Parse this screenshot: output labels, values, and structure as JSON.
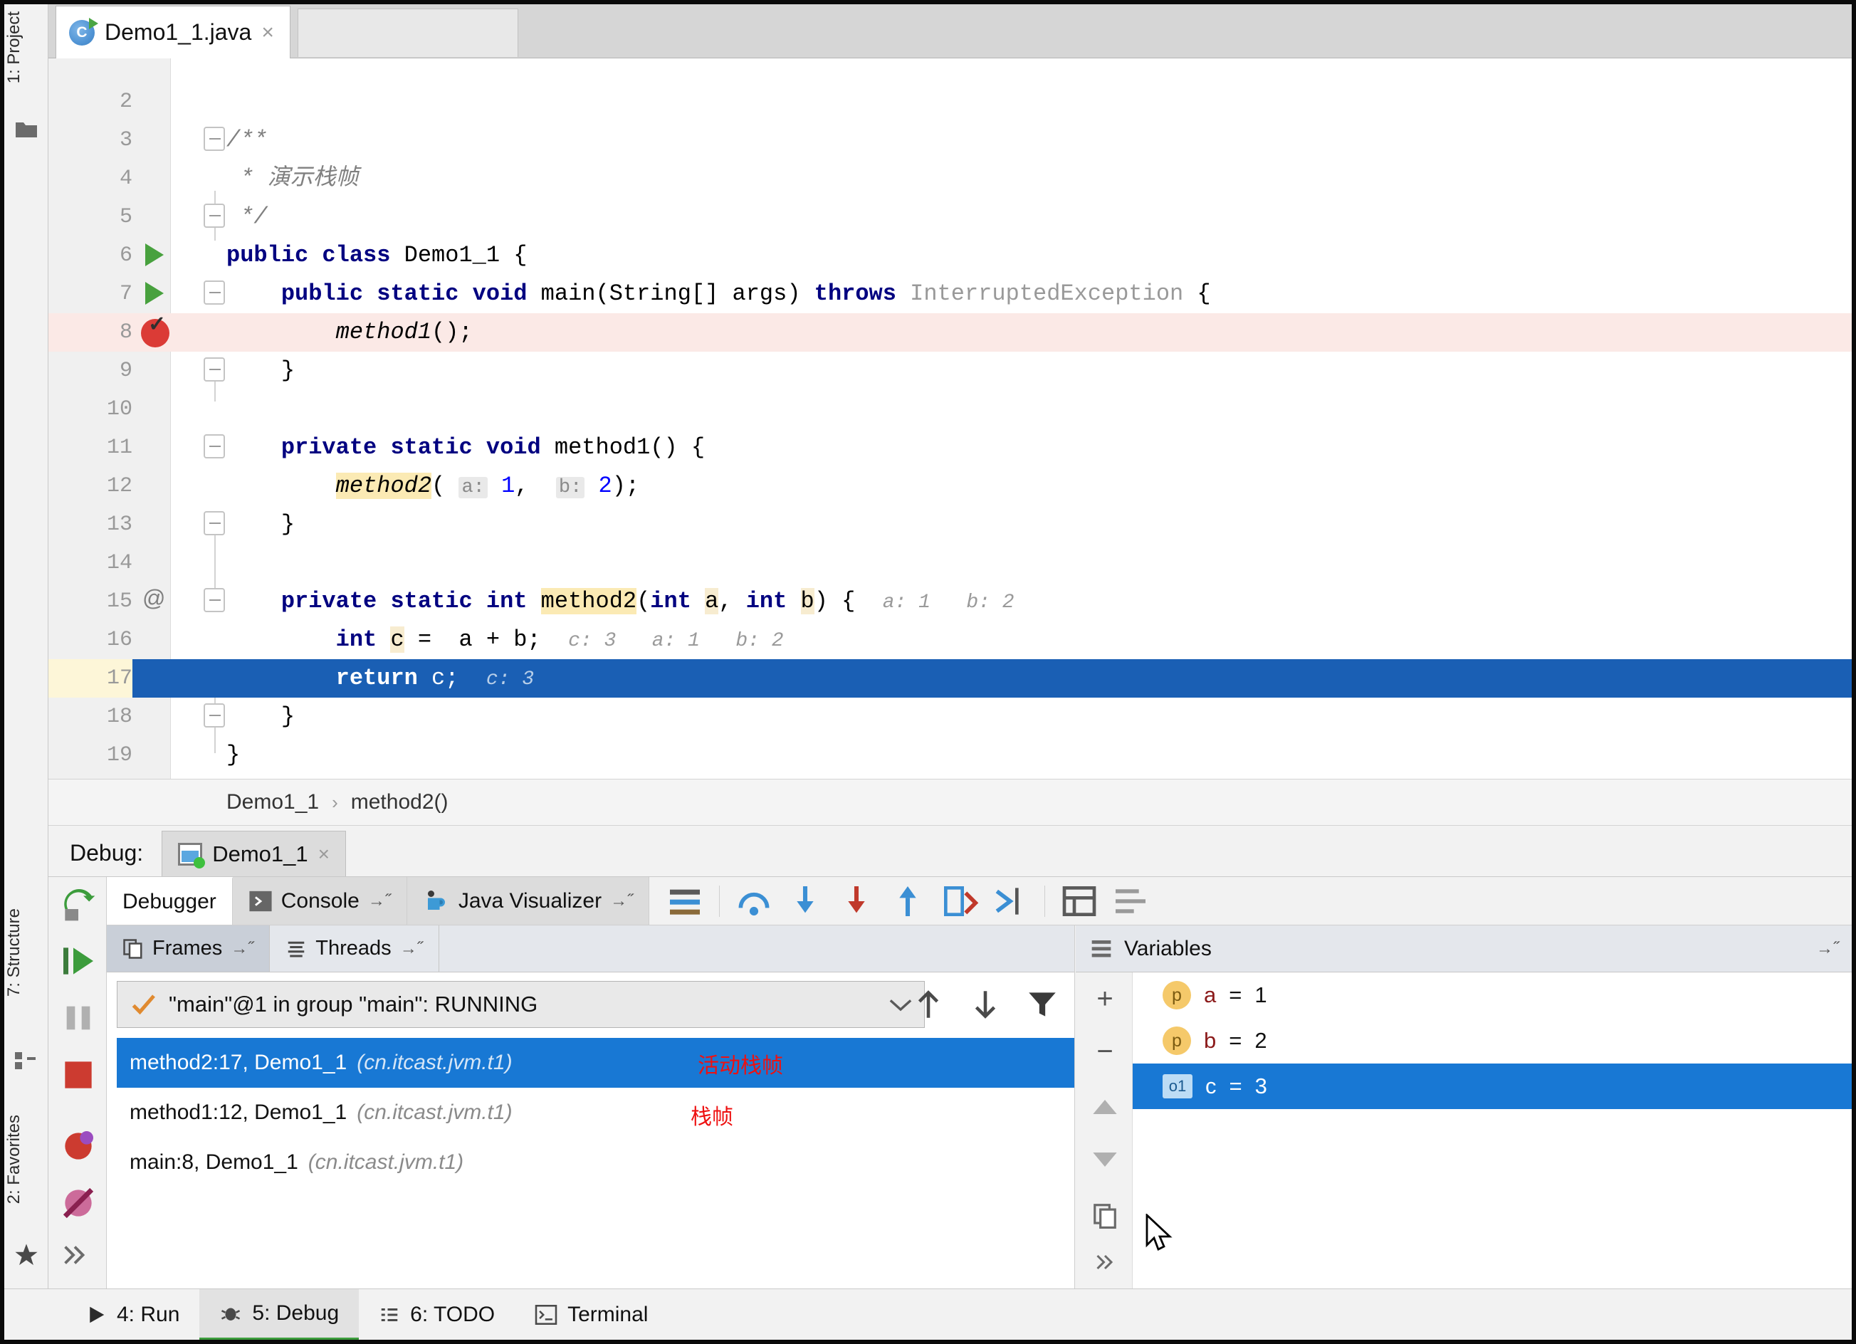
{
  "rail": {
    "project": "1: Project",
    "structure": "7: Structure",
    "favorites": "2: Favorites"
  },
  "editor_tab": {
    "title": "Demo1_1.java",
    "close": "×",
    "icon": "java-class-icon"
  },
  "code": {
    "lines": [
      {
        "n": "2",
        "text": ""
      },
      {
        "n": "3",
        "text": "/**"
      },
      {
        "n": "4",
        "text": " * 演示栈帧"
      },
      {
        "n": "5",
        "text": " */"
      },
      {
        "n": "6",
        "text": "public class Demo1_1 {"
      },
      {
        "n": "7",
        "text": "    public static void main(String[] args) throws InterruptedException {"
      },
      {
        "n": "8",
        "text": "        method1();"
      },
      {
        "n": "9",
        "text": "    }"
      },
      {
        "n": "10",
        "text": ""
      },
      {
        "n": "11",
        "text": "    private static void method1() {"
      },
      {
        "n": "12",
        "text": "        method2( a: 1,  b: 2);"
      },
      {
        "n": "13",
        "text": "    }"
      },
      {
        "n": "14",
        "text": ""
      },
      {
        "n": "15",
        "text": "    private static int method2(int a, int b) {   a: 1   b: 2"
      },
      {
        "n": "16",
        "text": "        int c =  a + b;   c: 3  a: 1  b: 2"
      },
      {
        "n": "17",
        "text": "        return c;   c: 3"
      },
      {
        "n": "18",
        "text": "    }"
      },
      {
        "n": "19",
        "text": "}"
      }
    ],
    "inline_hints": {
      "l12_a": "a:",
      "l12_a_val": "1",
      "l12_b": "b:",
      "l12_b_val": "2",
      "l15": "a: 1   b: 2",
      "l16": "c: 3   a: 1   b: 2",
      "l17": "c: 3"
    },
    "exec_line": "17",
    "breakpoint_line": "8"
  },
  "breadcrumb": {
    "class": "Demo1_1",
    "separator": "›",
    "method": "method2()"
  },
  "debug_header": {
    "label": "Debug:",
    "tab": "Demo1_1",
    "close": "×"
  },
  "debug_tabs": [
    {
      "label": "Debugger",
      "active": true,
      "pin": ""
    },
    {
      "label": "Console",
      "active": false,
      "pin": "→˝",
      "icon": "console-icon"
    },
    {
      "label": "Java Visualizer",
      "active": false,
      "pin": "→˝",
      "icon": "java-visualizer-icon"
    }
  ],
  "frames_panel": {
    "subtabs": [
      {
        "label": "Frames",
        "pin": "→˝",
        "selected": true,
        "icon": "frames-icon"
      },
      {
        "label": "Threads",
        "pin": "→˝",
        "selected": false,
        "icon": "threads-icon"
      }
    ],
    "thread": "\"main\"@1 in group \"main\": RUNNING",
    "frames": [
      {
        "sig": "method2:17, Demo1_1",
        "pkg": "(cn.itcast.jvm.t1)",
        "selected": true
      },
      {
        "sig": "method1:12, Demo1_1",
        "pkg": "(cn.itcast.jvm.t1)",
        "selected": false
      },
      {
        "sig": "main:8, Demo1_1",
        "pkg": "(cn.itcast.jvm.t1)",
        "selected": false
      }
    ],
    "annotations": [
      {
        "text": "活动栈帧",
        "color": "#ee1111"
      },
      {
        "text": "栈帧",
        "color": "#ee1111"
      }
    ]
  },
  "variables_panel": {
    "title": "Variables",
    "pin": "→˝",
    "rows": [
      {
        "icon": "p",
        "name": "a",
        "eq": "=",
        "value": "1",
        "selected": false
      },
      {
        "icon": "p",
        "name": "b",
        "eq": "=",
        "value": "2",
        "selected": false
      },
      {
        "icon": "o1",
        "name": "c",
        "eq": "=",
        "value": "3",
        "selected": true
      }
    ]
  },
  "status_bar": [
    {
      "label": "4: Run",
      "icon": "run-icon",
      "active": false
    },
    {
      "label": "5: Debug",
      "icon": "debug-icon",
      "active": true
    },
    {
      "label": "6: TODO",
      "icon": "todo-icon",
      "active": false
    },
    {
      "label": "Terminal",
      "icon": "terminal-icon",
      "active": false
    }
  ],
  "colors": {
    "exec_highlight": "#1a5fb4",
    "selection_blue": "#1878d4",
    "breakpoint_red": "#db3b36",
    "annotation_red": "#ee1111",
    "keyword_blue": "#000080"
  }
}
